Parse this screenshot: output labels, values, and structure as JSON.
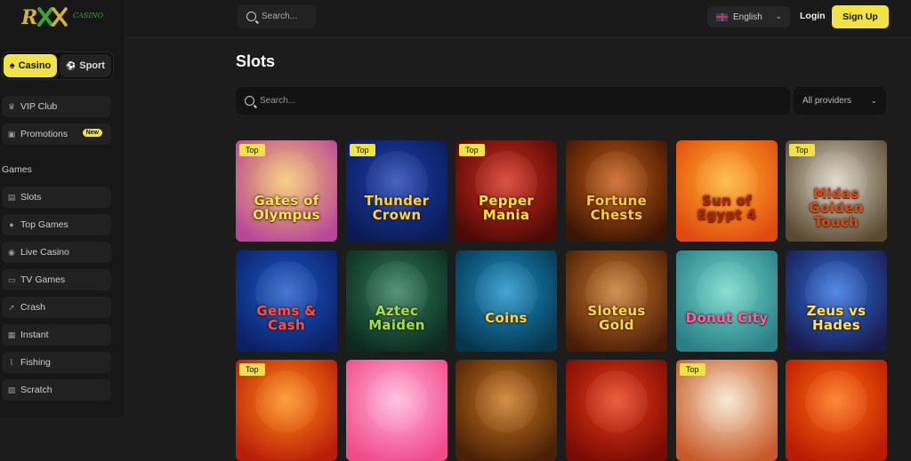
{
  "brand": {
    "logo_text": "RX",
    "logo_sub": "CASINO"
  },
  "sidebar": {
    "modes": [
      {
        "label": "Casino",
        "icon": "spade-icon",
        "active": true
      },
      {
        "label": "Sport",
        "icon": "ball-icon",
        "active": false
      }
    ],
    "top_items": [
      {
        "label": "VIP Club",
        "icon": "crown-icon"
      },
      {
        "label": "Promotions",
        "icon": "gift-icon",
        "badge": "New"
      }
    ],
    "section_label": "Games",
    "game_items": [
      {
        "label": "Slots",
        "icon": "slot-icon"
      },
      {
        "label": "Top Games",
        "icon": "star-icon"
      },
      {
        "label": "Live Casino",
        "icon": "live-icon"
      },
      {
        "label": "TV Games",
        "icon": "tv-icon"
      },
      {
        "label": "Crash",
        "icon": "rocket-icon"
      },
      {
        "label": "Instant",
        "icon": "bolt-icon"
      },
      {
        "label": "Fishing",
        "icon": "fish-icon"
      },
      {
        "label": "Scratch",
        "icon": "scratch-icon"
      }
    ]
  },
  "header": {
    "search_placeholder": "Search...",
    "language": "English",
    "login_label": "Login",
    "signup_label": "Sign Up"
  },
  "main": {
    "title": "Slots",
    "search_placeholder": "Search...",
    "providers_label": "All providers",
    "top_badge_label": "Top",
    "games": [
      {
        "title": "Gates of Olympus",
        "top": true,
        "bg": [
          "#f6c46a",
          "#b8479a"
        ],
        "color": "#ffe15a"
      },
      {
        "title": "Thunder Crown",
        "top": true,
        "bg": [
          "#1b3fb0",
          "#0b1a55"
        ],
        "color": "#ffd23a"
      },
      {
        "title": "Pepper Mania",
        "top": true,
        "bg": [
          "#d62a1a",
          "#4a0a06"
        ],
        "color": "#ffe23a"
      },
      {
        "title": "Fortune Chests",
        "top": false,
        "bg": [
          "#c85a12",
          "#3a1504"
        ],
        "color": "#ffcc33"
      },
      {
        "title": "Sun of Egypt 4",
        "top": false,
        "bg": [
          "#ffb02a",
          "#e04a10"
        ],
        "color": "#b81f0e"
      },
      {
        "title": "Midas Golden Touch",
        "top": true,
        "bg": [
          "#d9d3c2",
          "#5b4a32"
        ],
        "color": "#d84a1a"
      },
      {
        "title": "Gems & Cash",
        "top": false,
        "bg": [
          "#1a58c8",
          "#0b1f66"
        ],
        "color": "#ff4a4a"
      },
      {
        "title": "Aztec Maiden",
        "top": false,
        "bg": [
          "#2f7b58",
          "#0c2a20"
        ],
        "color": "#9be14a"
      },
      {
        "title": "Coins",
        "top": false,
        "bg": [
          "#1a8fc8",
          "#06354d"
        ],
        "color": "#ffd23a"
      },
      {
        "title": "Sloteus Gold",
        "top": false,
        "bg": [
          "#c8782a",
          "#4a1c06"
        ],
        "color": "#ffd84a"
      },
      {
        "title": "Donut City",
        "top": false,
        "bg": [
          "#6fd6c8",
          "#2a7e86"
        ],
        "color": "#ff5fa8"
      },
      {
        "title": "Zeus vs Hades",
        "top": false,
        "bg": [
          "#2c6fe0",
          "#1a1a4a"
        ],
        "color": "#ffe15a"
      },
      {
        "title": "",
        "top": true,
        "bg": [
          "#ff8a10",
          "#b81d0a"
        ],
        "color": "#ffd23a"
      },
      {
        "title": "",
        "top": false,
        "bg": [
          "#ffb6d6",
          "#f04a8a"
        ],
        "color": "#fff"
      },
      {
        "title": "",
        "top": false,
        "bg": [
          "#c8741c",
          "#4a2006"
        ],
        "color": "#fff"
      },
      {
        "title": "",
        "top": false,
        "bg": [
          "#e83a14",
          "#7a0a04"
        ],
        "color": "#fff"
      },
      {
        "title": "",
        "top": true,
        "bg": [
          "#f6e3c8",
          "#c85a2a"
        ],
        "color": "#fff"
      },
      {
        "title": "",
        "top": false,
        "bg": [
          "#ff6a0a",
          "#b81a04"
        ],
        "color": "#fff"
      }
    ]
  },
  "colors": {
    "accent": "#f2e24a",
    "bg": "#1c1c1c",
    "sidebar": "#171717"
  }
}
